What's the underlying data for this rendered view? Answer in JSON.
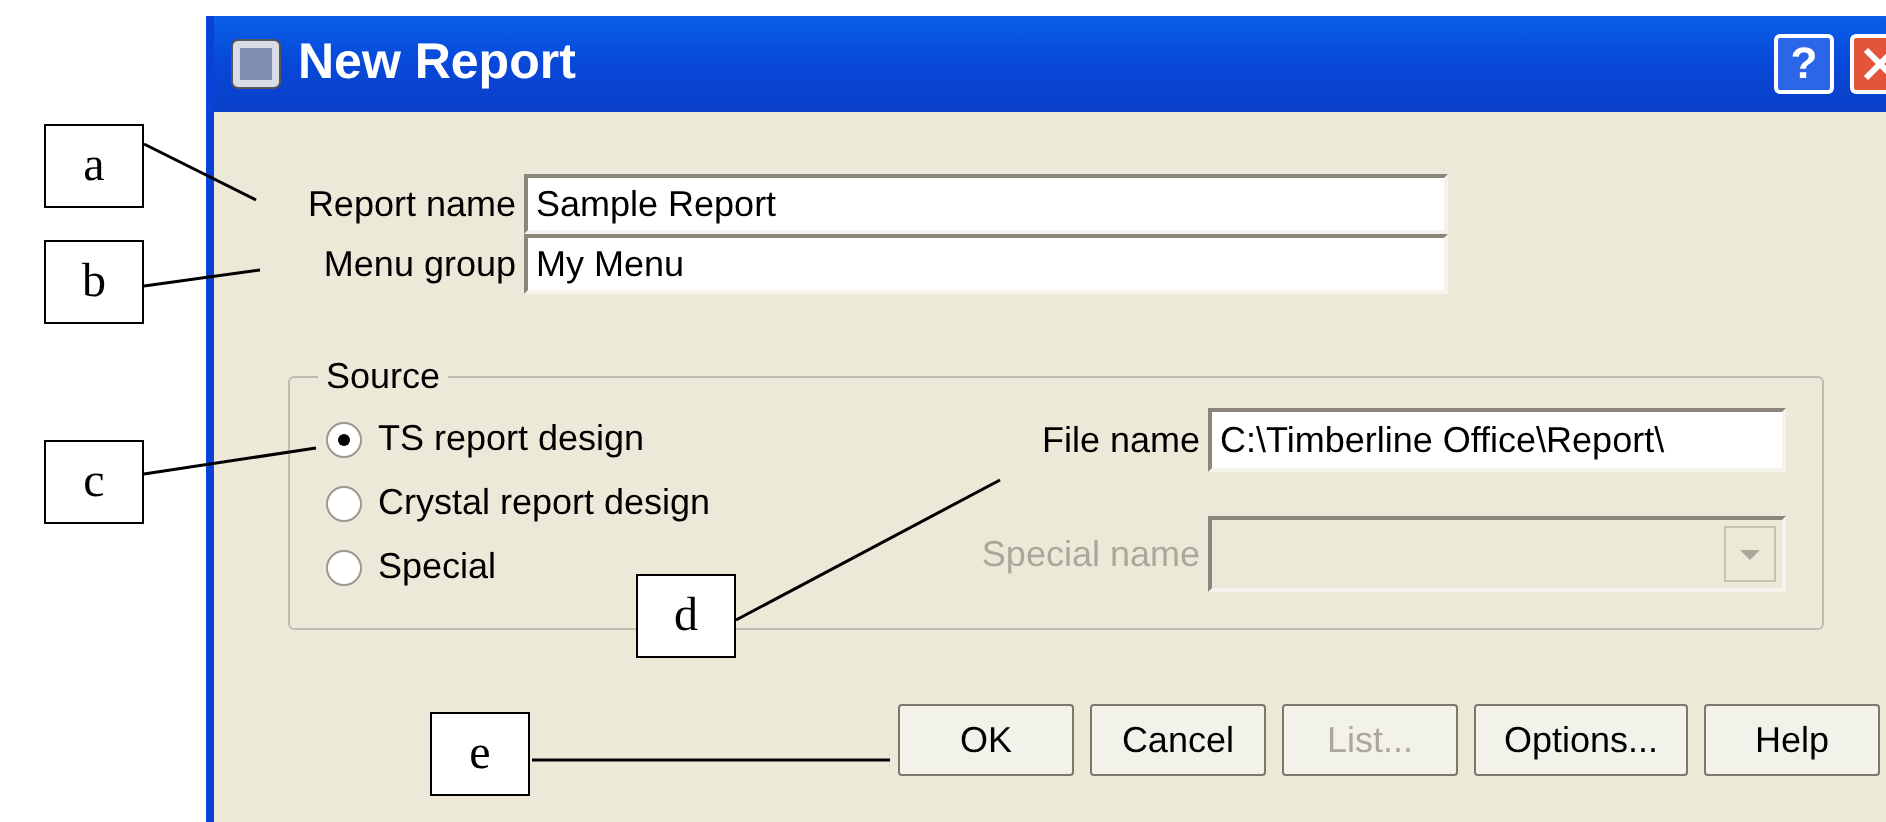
{
  "window": {
    "title": "New Report",
    "help_button": "?"
  },
  "fields": [
    {
      "label": "Report name",
      "value": "Sample Report"
    },
    {
      "label": "Menu group",
      "value": "My Menu"
    }
  ],
  "source": {
    "title": "Source",
    "options": [
      {
        "label": "TS report design",
        "selected": true
      },
      {
        "label": "Crystal report design",
        "selected": false
      },
      {
        "label": "Special",
        "selected": false
      }
    ],
    "file_name": {
      "label": "File name",
      "value": "C:\\Timberline Office\\Report\\"
    },
    "special_name": {
      "label": "Special name",
      "disabled": true
    }
  },
  "buttons": [
    {
      "label": "OK",
      "disabled": false
    },
    {
      "label": "Cancel",
      "disabled": false
    },
    {
      "label": "List...",
      "disabled": true
    },
    {
      "label": "Options...",
      "disabled": false
    },
    {
      "label": "Help",
      "disabled": false
    }
  ],
  "annotations": [
    {
      "label": "a"
    },
    {
      "label": "b"
    },
    {
      "label": "c"
    },
    {
      "label": "d"
    },
    {
      "label": "e"
    }
  ]
}
